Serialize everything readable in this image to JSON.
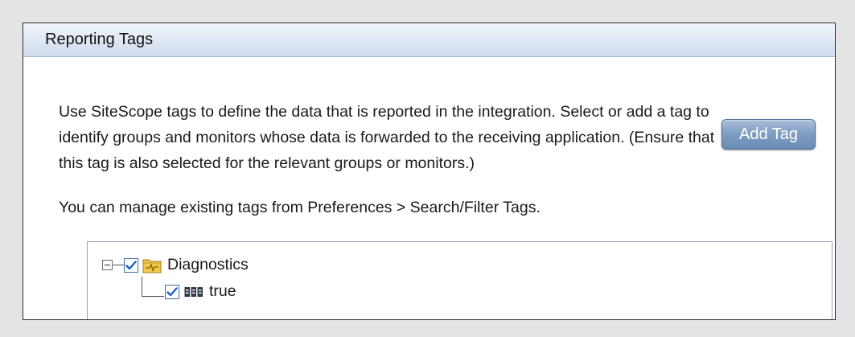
{
  "panel": {
    "title": "Reporting Tags"
  },
  "description": "Use SiteScope tags to define the data that is reported in the integration. Select or add a tag to identify groups and monitors whose data is forwarded to the receiving application. (Ensure that this tag is also selected for the relevant groups or monitors.)",
  "manage_note": "You can manage existing tags from Preferences > Search/Filter Tags.",
  "add_tag_button": "Add Tag",
  "tree": {
    "root": {
      "label": "Diagnostics",
      "checked": true,
      "expanded": true,
      "icon": "folder-icon"
    },
    "child": {
      "label": "true",
      "checked": true,
      "icon": "tag-values-icon"
    }
  },
  "colors": {
    "header_gradient_top": "#f2f6fb",
    "header_gradient_bottom": "#cfdced",
    "button_blue": "#7d9cc1",
    "checkbox_blue": "#1f5fbf"
  }
}
